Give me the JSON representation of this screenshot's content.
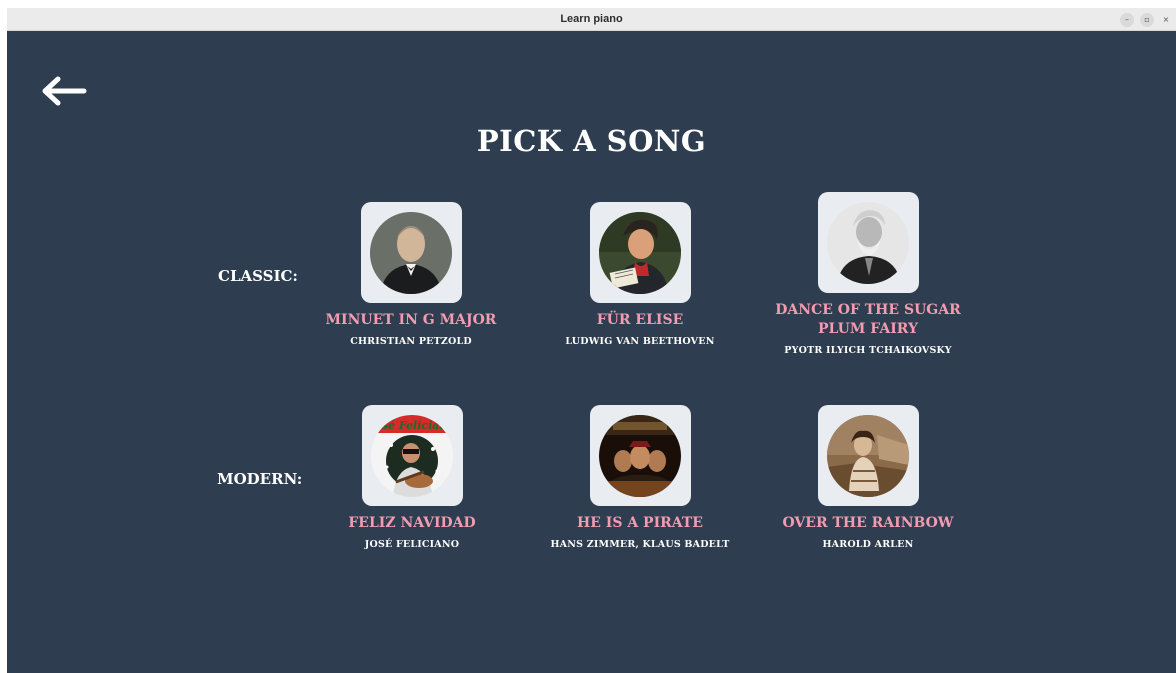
{
  "window": {
    "title": "Learn piano"
  },
  "window_controls": {
    "minimize": "–",
    "maximize": "▫",
    "close": "×"
  },
  "page": {
    "title": "PICK A SONG"
  },
  "sections": {
    "classic": {
      "label": "CLASSIC:",
      "songs": [
        {
          "title": "MINUET IN G MAJOR",
          "artist": "CHRISTIAN PETZOLD",
          "icon": "petzold-portrait"
        },
        {
          "title": "FÜR ELISE",
          "artist": "LUDWIG VAN BEETHOVEN",
          "icon": "beethoven-portrait"
        },
        {
          "title": "DANCE OF THE SUGAR PLUM FAIRY",
          "artist": "PYOTR ILYICH TCHAIKOVSKY",
          "icon": "tchaikovsky-portrait"
        }
      ]
    },
    "modern": {
      "label": "MODERN:",
      "songs": [
        {
          "title": "FELIZ NAVIDAD",
          "artist": "JOSÉ FELICIANO",
          "icon": "feliciano-album-cover",
          "cover_text": "José Feliciano"
        },
        {
          "title": "HE IS A PIRATE",
          "artist": "HANS ZIMMER, KLAUS BADELT",
          "icon": "pirates-poster"
        },
        {
          "title": "OVER THE RAINBOW",
          "artist": "HAROLD ARLEN",
          "icon": "wizard-of-oz-photo"
        }
      ]
    }
  },
  "colors": {
    "background": "#2e3d4f",
    "song_title": "#f29cb0",
    "card": "#e9edf1",
    "text": "#ffffff"
  }
}
